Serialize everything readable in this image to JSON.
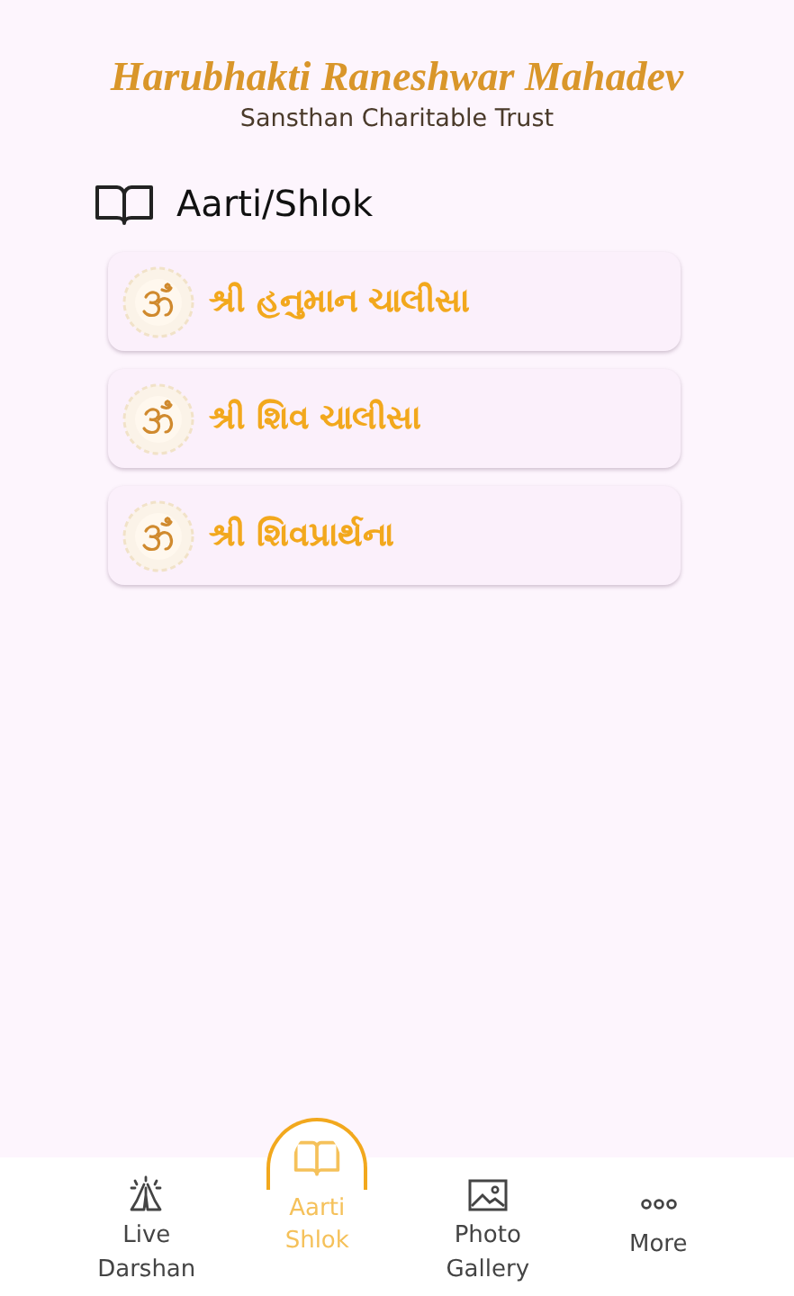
{
  "header": {
    "title": "Harubhakti Raneshwar Mahadev",
    "subtitle": "Sansthan Charitable Trust"
  },
  "section": {
    "title": "Aarti/Shlok"
  },
  "items": [
    {
      "label": "શ્રી હનુમાન ચાલીસા"
    },
    {
      "label": "શ્રી શિવ ચાલીસા"
    },
    {
      "label": "શ્રી શિવપ્રાર્થના"
    }
  ],
  "nav": [
    {
      "kind": "pray",
      "lines": [
        "Live",
        "Darshan"
      ],
      "selected": false
    },
    {
      "kind": "book",
      "lines": [
        "Aarti",
        "Shlok"
      ],
      "selected": true
    },
    {
      "kind": "photo",
      "lines": [
        "Photo",
        "Gallery"
      ],
      "selected": false
    },
    {
      "kind": "more",
      "lines": [
        "More"
      ],
      "selected": false
    }
  ]
}
